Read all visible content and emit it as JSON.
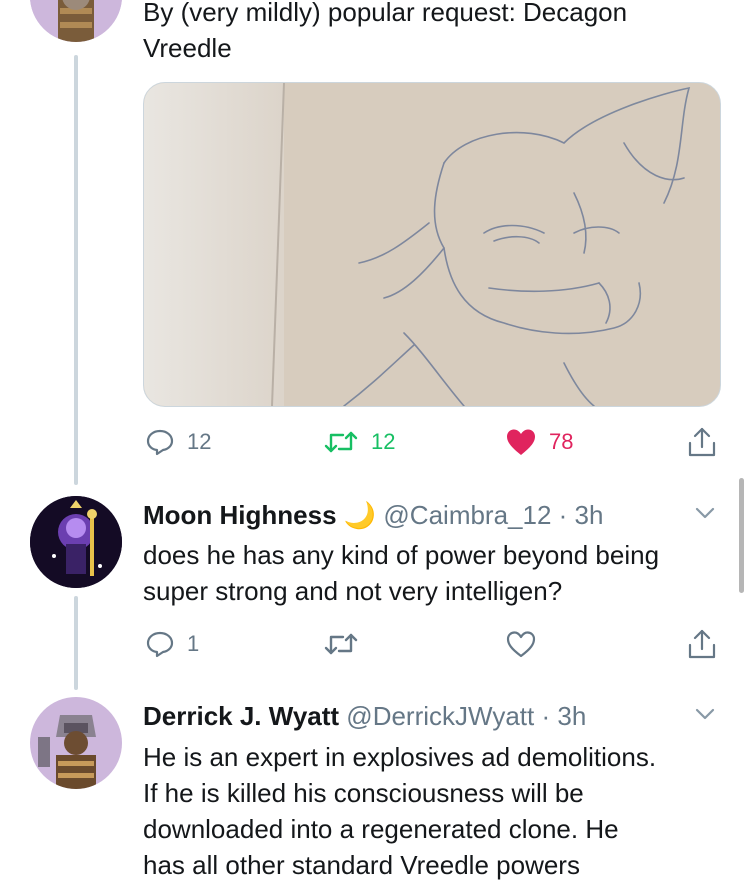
{
  "tweet": {
    "text_line1": "By (very mildly) popular request: Decagon",
    "text_line2": "Vreedle",
    "reply_count": "12",
    "retweet_count": "12",
    "like_count": "78"
  },
  "reply1": {
    "name": "Moon Highness",
    "emoji": "🌙",
    "handle": "@Caimbra_12",
    "time": "· 3h",
    "line1": "does he has any kind of power beyond being",
    "line2": "super strong and not very intelligen?",
    "reply_count": "1"
  },
  "reply2": {
    "name": "Derrick J. Wyatt",
    "handle": "@DerrickJWyatt",
    "time": "· 3h",
    "line1": "He is an expert in explosives ad demolitions.",
    "line2": "If he is killed his consciousness will be",
    "line3": "downloaded into a regenerated clone. He",
    "line4": "has all other standard Vreedle powers"
  },
  "colors": {
    "like_red": "#e0245e",
    "retweet_green": "#17bf63",
    "icon_gray": "#657786",
    "thread_line": "#ccd6dd"
  },
  "icons": [
    "reply-icon",
    "retweet-icon",
    "like-icon",
    "share-icon",
    "chevron-down-icon"
  ]
}
